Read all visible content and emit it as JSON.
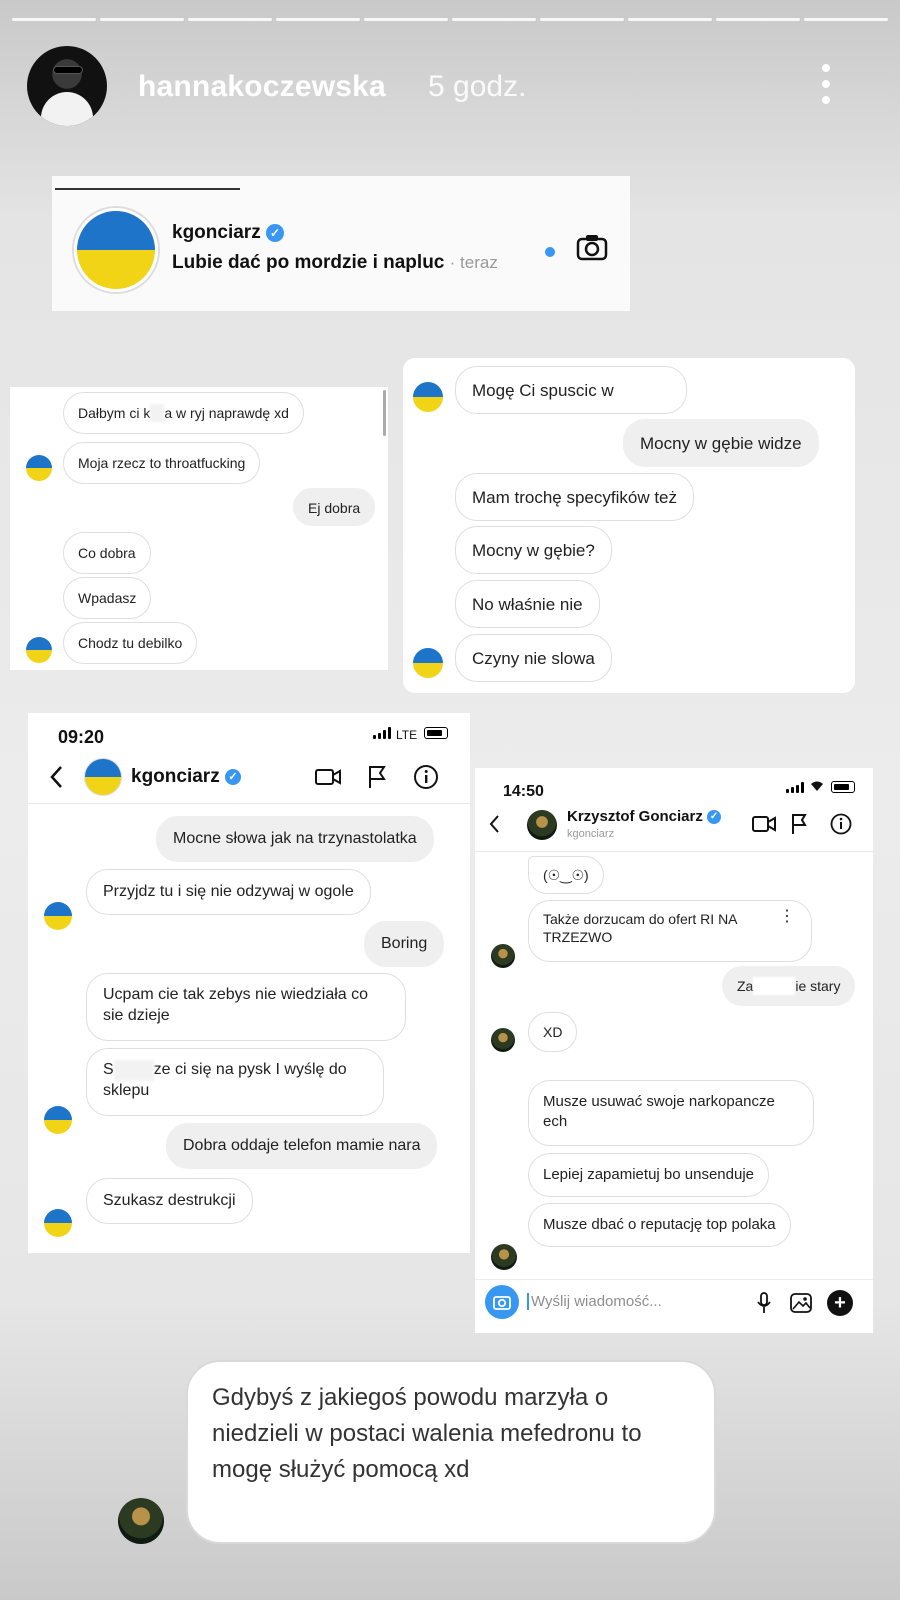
{
  "story": {
    "username": "hannakoczewska",
    "time": "5 godz."
  },
  "notification": {
    "username": "kgonciarz",
    "message": "Lubie dać po mordzie i napluc",
    "time": "· teraz"
  },
  "chat_left_top": [
    {
      "text": "Dałbym ci k",
      "text2": "a w ryj naprawdę xd"
    },
    {
      "text": "Moja rzecz to throatfucking"
    },
    {
      "text": "Ej dobra"
    },
    {
      "text": "Co dobra"
    },
    {
      "text": "Wpadasz"
    },
    {
      "text": "Chodz tu debilko"
    }
  ],
  "chat_right_top": [
    {
      "text": "Mogę Ci spuscic w"
    },
    {
      "text": "Mocny w gębie widze"
    },
    {
      "text": "Mam trochę specyfików też"
    },
    {
      "text": "Mocny w gębie?"
    },
    {
      "text": "No właśnie nie"
    },
    {
      "text": "Czyny nie slowa"
    }
  ],
  "phone_left": {
    "time": "09:20",
    "network": "LTE",
    "username": "kgonciarz",
    "messages": [
      {
        "text": "Mocne słowa jak na trzynastolatka"
      },
      {
        "text": "Przyjdz tu i się nie odzywaj w ogole"
      },
      {
        "text": "Boring"
      },
      {
        "text": "Ucpam cie tak zebys nie wiedziała co sie dzieje"
      },
      {
        "text": "S",
        "text2": "ze ci się na pysk I wyślę do sklepu"
      },
      {
        "text": "Dobra oddaje telefon mamie nara"
      },
      {
        "text": "Szukasz destrukcji"
      }
    ]
  },
  "phone_right": {
    "time": "14:50",
    "name": "Krzysztof Gonciarz",
    "handle": "kgonciarz",
    "messages": [
      {
        "text": "(☉‿☉)"
      },
      {
        "text": "Także dorzucam do ofert RI NA TRZEZWO"
      },
      {
        "text": "Za",
        "text2": "ie stary"
      },
      {
        "text": "XD"
      },
      {
        "text": "Musze usuwać swoje narkopancze ech"
      },
      {
        "text": "Lepiej zapamietuj bo unsenduje"
      },
      {
        "text": "Musze dbać o reputację top polaka"
      }
    ],
    "input_placeholder": "Wyślij wiadomość..."
  },
  "bottom_message": "Gdybyś z jakiegoś powodu marzyła o niedzieli w postaci walenia mefedronu to mogę służyć pomocą xd"
}
